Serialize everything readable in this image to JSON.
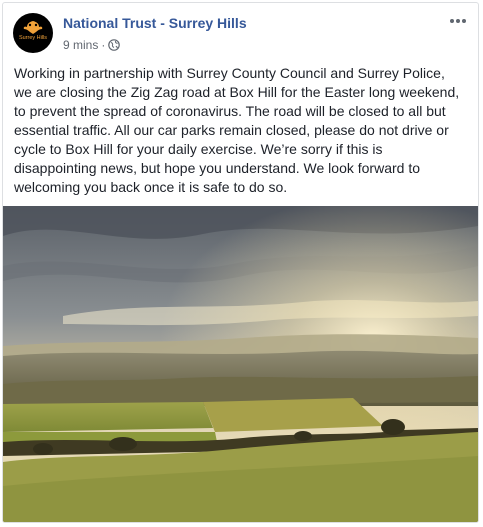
{
  "post": {
    "page_name": "National Trust - Surrey Hills",
    "avatar_text": "Surrey Hills",
    "timestamp": "9 mins",
    "separator": "·",
    "privacy_icon": "globe-icon",
    "more_icon": "more-options-icon",
    "body": "Working in partnership with Surrey County Council and Surrey Police, we are closing the Zig Zag road at Box Hill for the Easter long weekend, to prevent the spread of coronavirus. The road will be closed to all but essential traffic. All our car parks remain closed, please do not drive or cycle to Box Hill for your daily exercise. We’re sorry if this is disappointing news, but hope you understand. We look forward to welcoming you back once it is safe to do so.",
    "photo": "landscape-photo"
  },
  "colors": {
    "page_name": "#365899",
    "meta": "#616770",
    "text": "#1d2129",
    "border": "#dddfe2",
    "avatar_bg": "#000000",
    "brand_orange": "#f0a23a"
  }
}
